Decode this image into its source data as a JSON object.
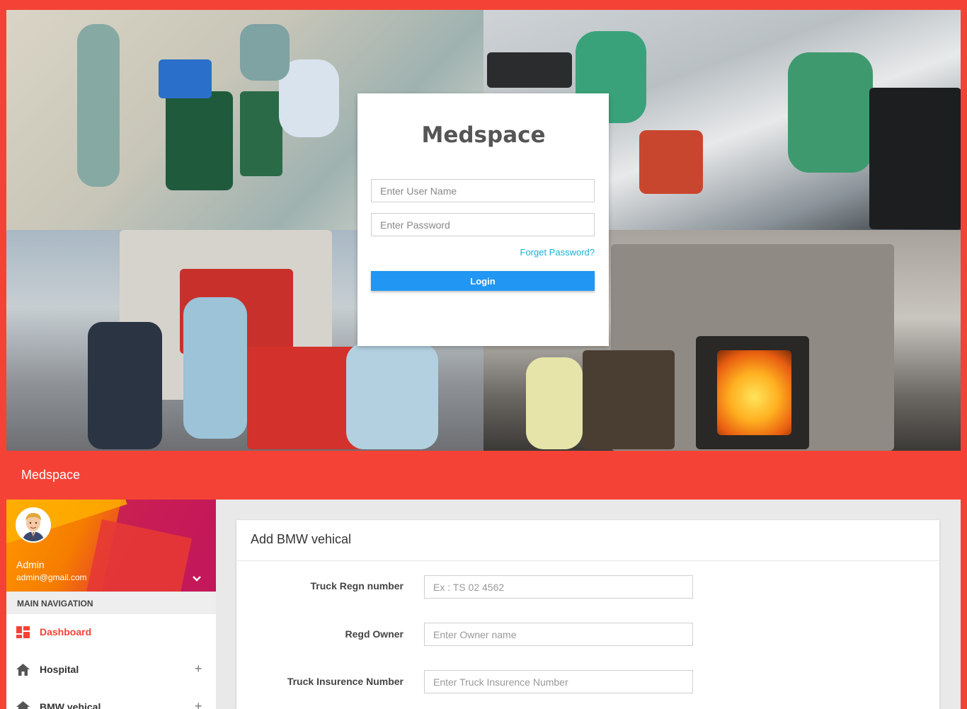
{
  "login": {
    "title": "Medspace",
    "username_placeholder": "Enter User Name",
    "password_placeholder": "Enter Password",
    "forgot_label": "Forget Password?",
    "login_label": "Login"
  },
  "app": {
    "title": "Medspace"
  },
  "sidebar": {
    "user": {
      "name": "Admin",
      "email": "admin@gmail.com"
    },
    "nav_header": "MAIN NAVIGATION",
    "items": [
      {
        "label": "Dashboard",
        "icon": "dashboard-icon",
        "active": true
      },
      {
        "label": "Hospital",
        "icon": "home-icon",
        "expandable": true
      },
      {
        "label": "BMW vehical",
        "icon": "home-icon",
        "expandable": true
      }
    ]
  },
  "form": {
    "title": "Add BMW vehical",
    "fields": [
      {
        "label": "Truck Regn number",
        "placeholder": "Ex : TS 02 4562"
      },
      {
        "label": "Regd Owner",
        "placeholder": "Enter Owner name"
      },
      {
        "label": "Truck Insurence Number",
        "placeholder": "Enter Truck Insurence Number"
      }
    ]
  },
  "colors": {
    "brand": "#f44336",
    "primary_button": "#2196f3",
    "link": "#1ab0d6"
  }
}
